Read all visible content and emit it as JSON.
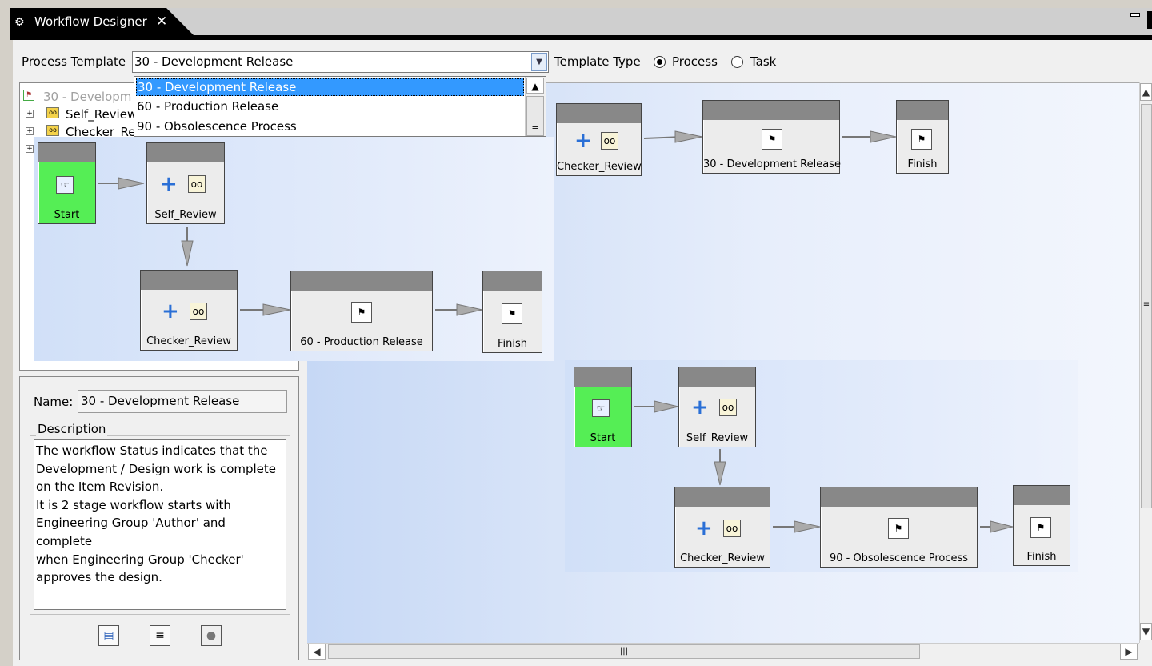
{
  "tab": {
    "title": "Workflow Designer",
    "close": "✕"
  },
  "toolbar": {
    "process_template_label": "Process Template",
    "process_template_value": "30 - Development Release",
    "template_type_label": "Template Type",
    "radio_process_label": "Process",
    "radio_task_label": "Task",
    "selected_type": "Process"
  },
  "dropdown": {
    "options": [
      "30 - Development Release",
      "60 - Production Release",
      "90 - Obsolescence Process"
    ],
    "selected_index": 0
  },
  "tree": {
    "root": "30 - Developm",
    "items": [
      "Self_Review",
      "Checker_Re"
    ]
  },
  "properties": {
    "name_label": "Name:",
    "name_value": "30 - Development Release",
    "description_label": "Description",
    "description_text": "The workflow Status indicates that the\nDevelopment / Design work is complete\non the Item Revision.\nIt is 2 stage workflow starts with\nEngineering Group 'Author' and complete\nwhen Engineering Group 'Checker'\napproves the design."
  },
  "workflows": {
    "dev_release": {
      "checker": "Checker_Review",
      "status": "30 - Development Release",
      "finish": "Finish"
    },
    "prod_release": {
      "start": "Start",
      "self_review": "Self_Review",
      "checker": "Checker_Review",
      "status": "60 - Production Release",
      "finish": "Finish"
    },
    "obsolescence": {
      "start": "Start",
      "self_review": "Self_Review",
      "checker": "Checker_Review",
      "status": "90 - Obsolescence Process",
      "finish": "Finish"
    }
  },
  "colors": {
    "start_node": "#55ee55",
    "node_header": "#888888",
    "selection": "#3399ff",
    "tab_background": "#000000"
  }
}
